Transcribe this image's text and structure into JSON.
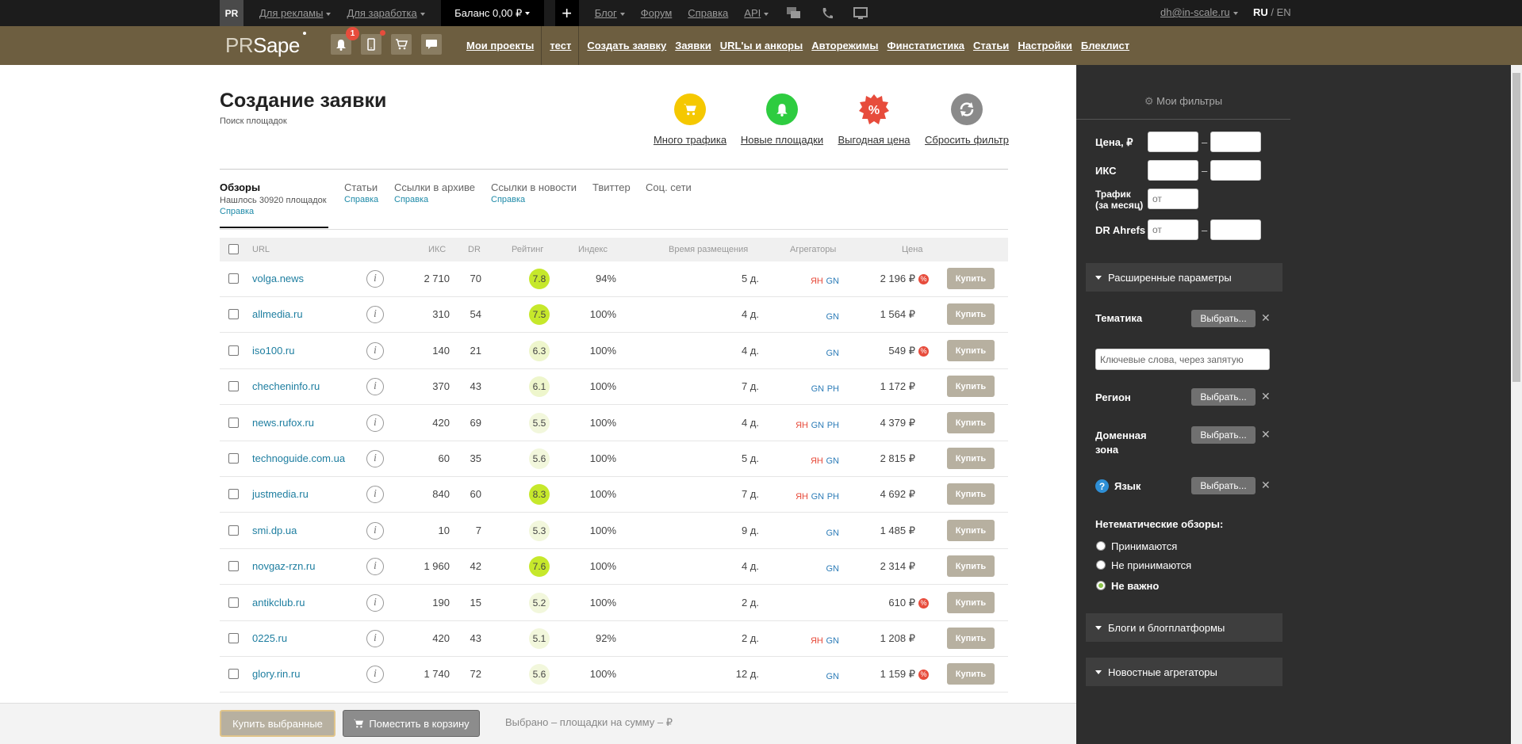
{
  "topbar": {
    "logo": "PR",
    "links": [
      "Для рекламы",
      "Для заработка"
    ],
    "balance": "Баланс 0,00 ₽",
    "plus": "+",
    "links2": [
      "Блог",
      "Форум",
      "Справка",
      "API"
    ],
    "email": "dh@in-scale.ru",
    "lang_ru": "RU",
    "lang_sep": " / ",
    "lang_en": "EN"
  },
  "navbar": {
    "brand_pr": "PR",
    "brand_sape": "Sape",
    "notif_count": "1",
    "links": [
      "Мои проекты",
      "тест",
      "Создать заявку",
      "Заявки",
      "URL'ы и анкоры",
      "Авторежимы",
      "Финстатистика",
      "Статьи",
      "Настройки",
      "Блеклист"
    ]
  },
  "page": {
    "title": "Создание заявки",
    "subtitle": "Поиск площадок",
    "quick_filters": [
      {
        "label": "Много трафика",
        "color": "#f5c800",
        "icon": "cart-icon"
      },
      {
        "label": "Новые площадки",
        "color": "#2ecc40",
        "icon": "bell-icon"
      },
      {
        "label": "Выгодная цена",
        "color": "#e74c3c",
        "icon": "percent-badge-icon"
      },
      {
        "label": "Сбросить фильтр",
        "color": "#8a8a8a",
        "icon": "reset-icon"
      }
    ]
  },
  "tabs": {
    "items": [
      "Обзоры",
      "Статьи",
      "Ссылки в архиве",
      "Ссылки в новости",
      "Твиттер",
      "Соц. сети"
    ],
    "found": "Нашлось 30920 площадок",
    "help": "Справка"
  },
  "table": {
    "headers": [
      "URL",
      "ИКС",
      "DR",
      "Рейтинг",
      "Индекс",
      "Время размещения",
      "Агрегаторы",
      "Цена"
    ],
    "buy_label": "Купить",
    "rows": [
      {
        "url": "volga.news",
        "iks": "2 710",
        "dr": "70",
        "rating": "7.8",
        "index": "94%",
        "time": "5 д.",
        "yan": "ЯН",
        "gn": "GN",
        "ph": "",
        "price": "2 196 ₽",
        "discount": true
      },
      {
        "url": "allmedia.ru",
        "iks": "310",
        "dr": "54",
        "rating": "7.5",
        "index": "100%",
        "time": "4 д.",
        "yan": "",
        "gn": "GN",
        "ph": "",
        "price": "1 564 ₽",
        "discount": false
      },
      {
        "url": "iso100.ru",
        "iks": "140",
        "dr": "21",
        "rating": "6.3",
        "index": "100%",
        "time": "4 д.",
        "yan": "",
        "gn": "GN",
        "ph": "",
        "price": "549 ₽",
        "discount": true
      },
      {
        "url": "checheninfo.ru",
        "iks": "370",
        "dr": "43",
        "rating": "6.1",
        "index": "100%",
        "time": "7 д.",
        "yan": "",
        "gn": "GN",
        "ph": "PH",
        "price": "1 172 ₽",
        "discount": false
      },
      {
        "url": "news.rufox.ru",
        "iks": "420",
        "dr": "69",
        "rating": "5.5",
        "index": "100%",
        "time": "4 д.",
        "yan": "ЯН",
        "gn": "GN",
        "ph": "PH",
        "price": "4 379 ₽",
        "discount": false
      },
      {
        "url": "technoguide.com.ua",
        "iks": "60",
        "dr": "35",
        "rating": "5.6",
        "index": "100%",
        "time": "5 д.",
        "yan": "ЯН",
        "gn": "GN",
        "ph": "",
        "price": "2 815 ₽",
        "discount": false
      },
      {
        "url": "justmedia.ru",
        "iks": "840",
        "dr": "60",
        "rating": "8.3",
        "index": "100%",
        "time": "7 д.",
        "yan": "ЯН",
        "gn": "GN",
        "ph": "PH",
        "price": "4 692 ₽",
        "discount": false
      },
      {
        "url": "smi.dp.ua",
        "iks": "10",
        "dr": "7",
        "rating": "5.3",
        "index": "100%",
        "time": "9 д.",
        "yan": "",
        "gn": "GN",
        "ph": "",
        "price": "1 485 ₽",
        "discount": false
      },
      {
        "url": "novgaz-rzn.ru",
        "iks": "1 960",
        "dr": "42",
        "rating": "7.6",
        "index": "100%",
        "time": "4 д.",
        "yan": "",
        "gn": "GN",
        "ph": "",
        "price": "2 314 ₽",
        "discount": false
      },
      {
        "url": "antikclub.ru",
        "iks": "190",
        "dr": "15",
        "rating": "5.2",
        "index": "100%",
        "time": "2 д.",
        "yan": "",
        "gn": "",
        "ph": "",
        "price": "610 ₽",
        "discount": true
      },
      {
        "url": "0225.ru",
        "iks": "420",
        "dr": "43",
        "rating": "5.1",
        "index": "92%",
        "time": "2 д.",
        "yan": "ЯН",
        "gn": "GN",
        "ph": "",
        "price": "1 208 ₽",
        "discount": false
      },
      {
        "url": "glory.rin.ru",
        "iks": "1 740",
        "dr": "72",
        "rating": "5.6",
        "index": "100%",
        "time": "12 д.",
        "yan": "",
        "gn": "GN",
        "ph": "",
        "price": "1 159 ₽",
        "discount": true
      }
    ]
  },
  "sidebar": {
    "my_filters": "Мои фильтры",
    "price_label": "Цена, ₽",
    "iks_label": "ИКС",
    "traffic_label_1": "Трафик",
    "traffic_label_2": "(за месяц)",
    "traffic_placeholder": "от",
    "dr_label": "DR Ahrefs",
    "dr_placeholder": "от",
    "dash": "–",
    "extended": "Расширенные параметры",
    "topic": "Тематика",
    "choose": "Выбрать...",
    "keywords_placeholder": "Ключевые слова, через запятую",
    "region": "Регион",
    "domain_zone_1": "Доменная",
    "domain_zone_2": "зона",
    "language": "Язык",
    "nonthematic": "Нетематические обзоры:",
    "radio": [
      "Принимаются",
      "Не принимаются",
      "Не важно"
    ],
    "blogs": "Блоги и блогплатформы",
    "news_agg": "Новостные агрегаторы"
  },
  "bottom": {
    "buy_selected": "Купить выбранные",
    "to_cart": "Поместить в корзину",
    "selected_info": "Выбрано – площадки на сумму – ₽"
  }
}
